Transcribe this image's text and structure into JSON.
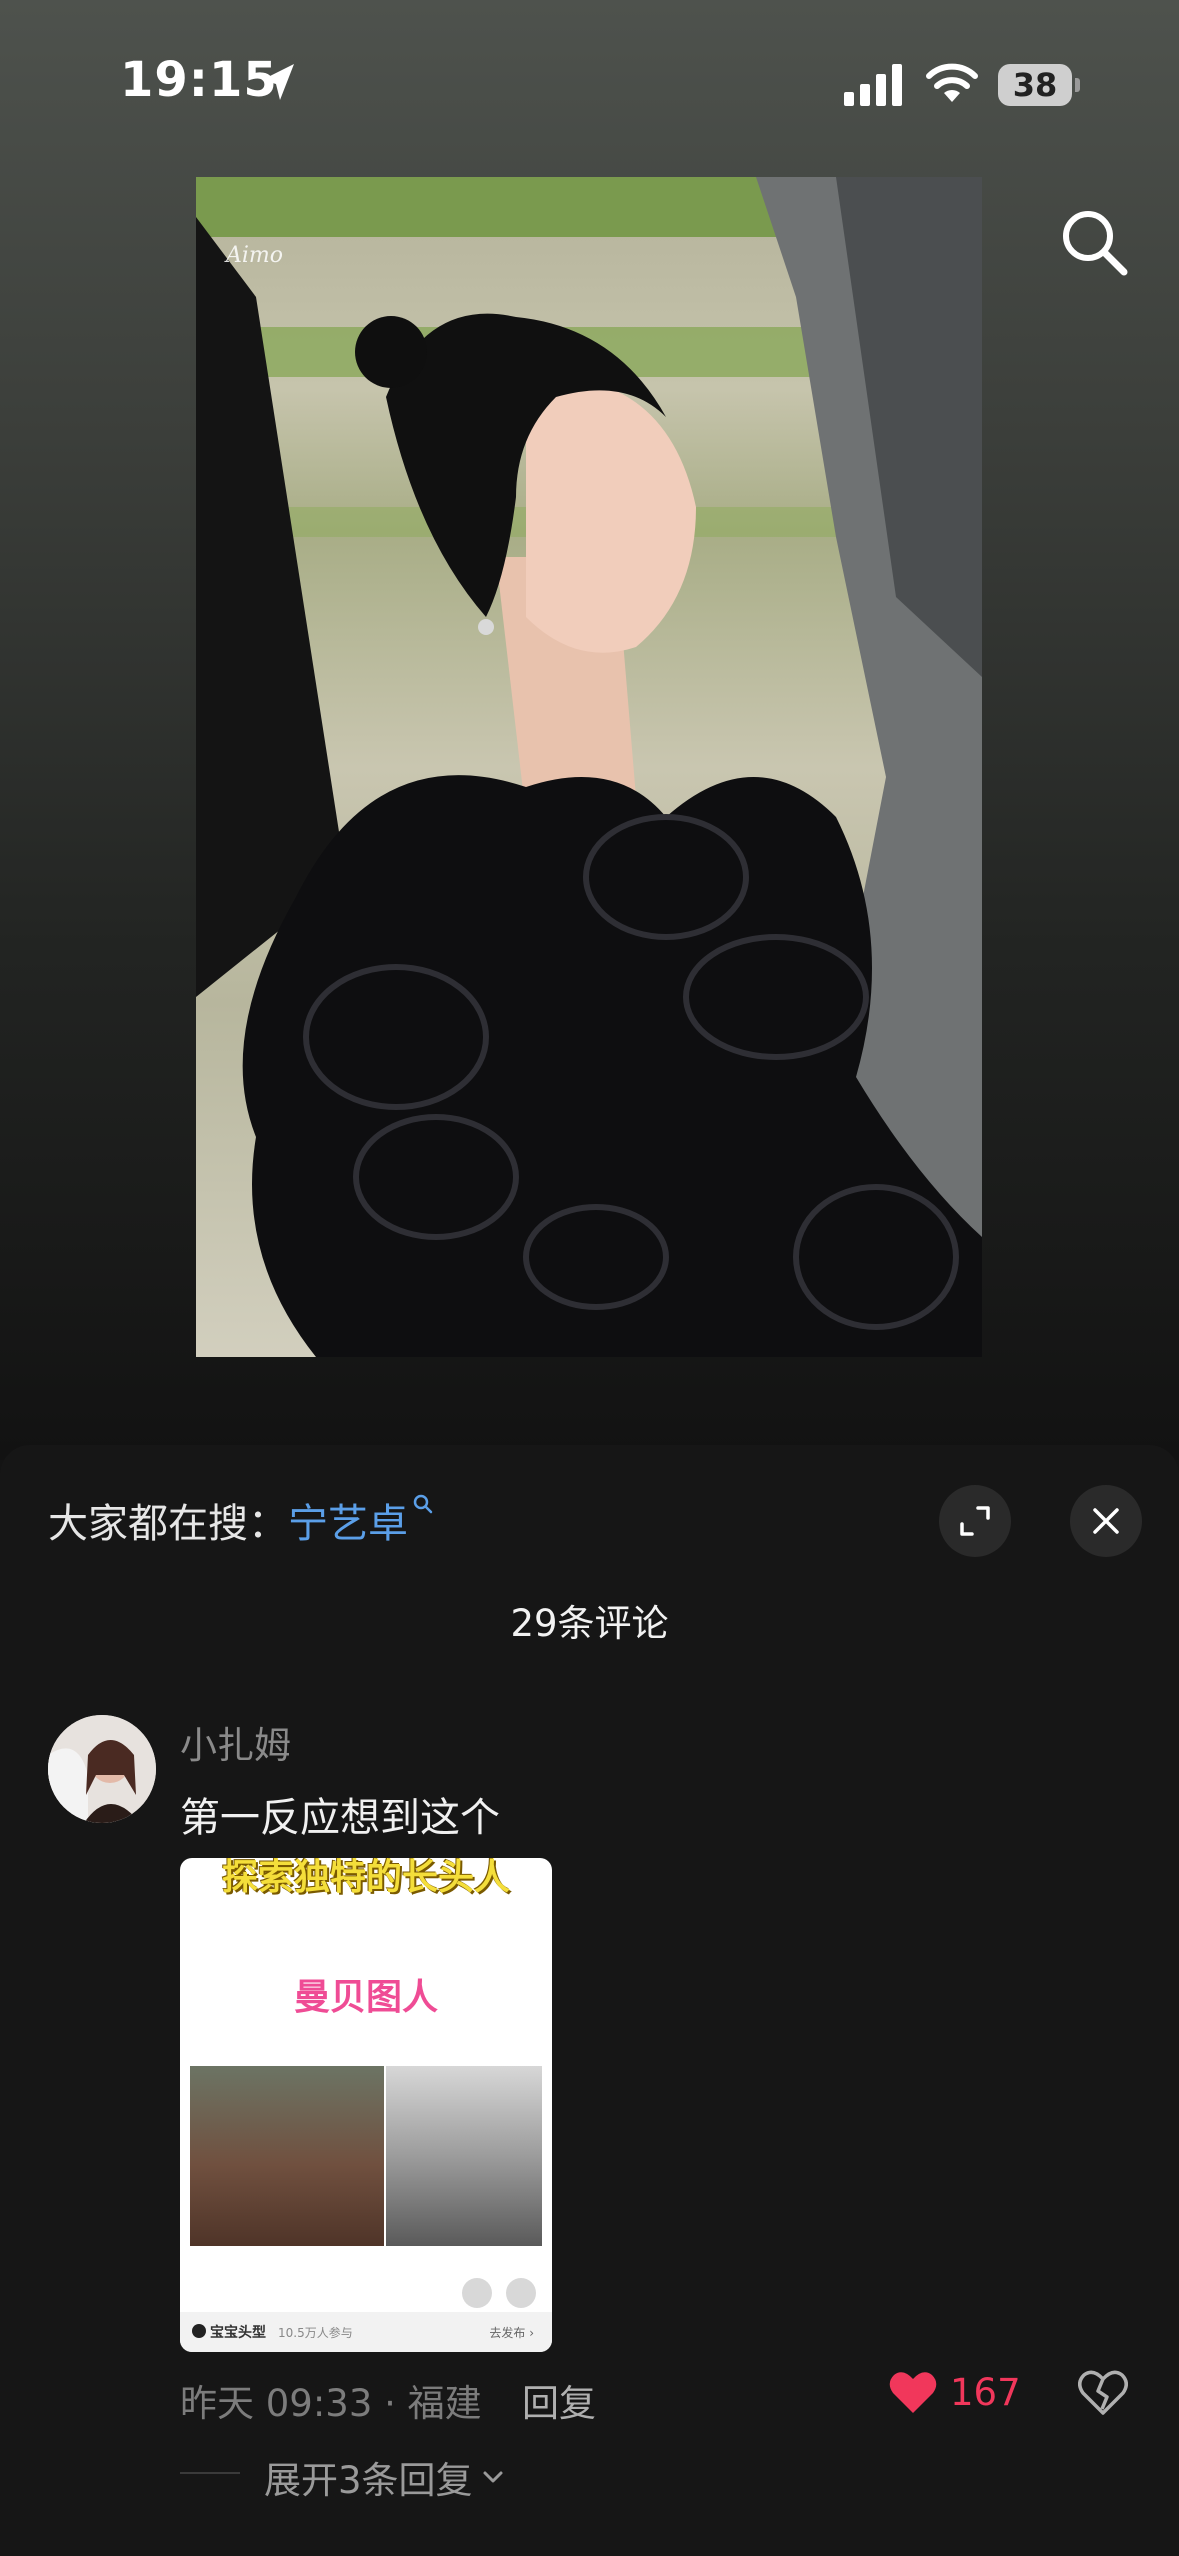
{
  "status_bar": {
    "time": "19:15",
    "battery": "38"
  },
  "photo": {
    "watermark": "Aimo"
  },
  "panel": {
    "trend_prefix": "大家都在搜：",
    "trend_keyword": "宁艺卓",
    "comment_count": "29条评论"
  },
  "comment": {
    "username": "小扎姆",
    "text": "第一反应想到这个",
    "image": {
      "header": "探索独特的长头人",
      "title": "曼贝图人",
      "footer_brand": "宝宝头型",
      "footer_participants": "10.5万人参与",
      "footer_action": "去发布 ›"
    },
    "time": "昨天 09:33 · 福建",
    "reply_label": "回复",
    "likes": "167",
    "expand_replies": "展开3条回复"
  },
  "colors": {
    "accent_like": "#f1375b",
    "keyword": "#5b9fe8",
    "panel_bg": "#161616"
  },
  "icons": [
    "location-arrow-icon",
    "signal-icon",
    "wifi-icon",
    "battery-icon",
    "search-icon",
    "expand-icon",
    "close-icon",
    "heart-icon",
    "broken-heart-icon",
    "chevron-down-icon"
  ]
}
